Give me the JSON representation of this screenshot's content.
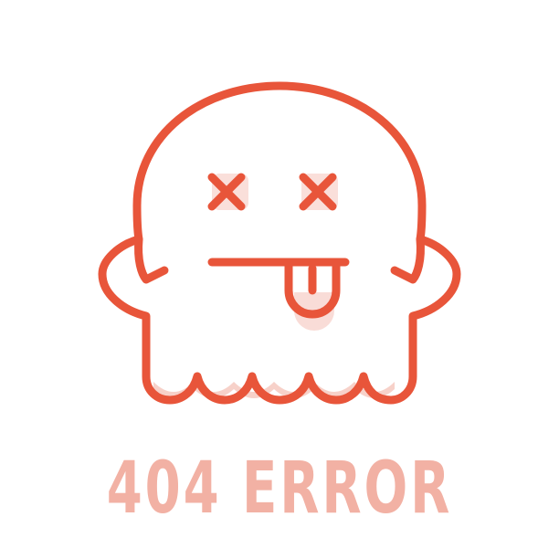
{
  "message": {
    "text": "404 ERROR"
  },
  "illustration": {
    "name": "dead-ghost-icon"
  },
  "colors": {
    "stroke": "#e8553a",
    "accent": "#f5c5bc",
    "text": "#f2b1a4",
    "background": "#ffffff"
  }
}
